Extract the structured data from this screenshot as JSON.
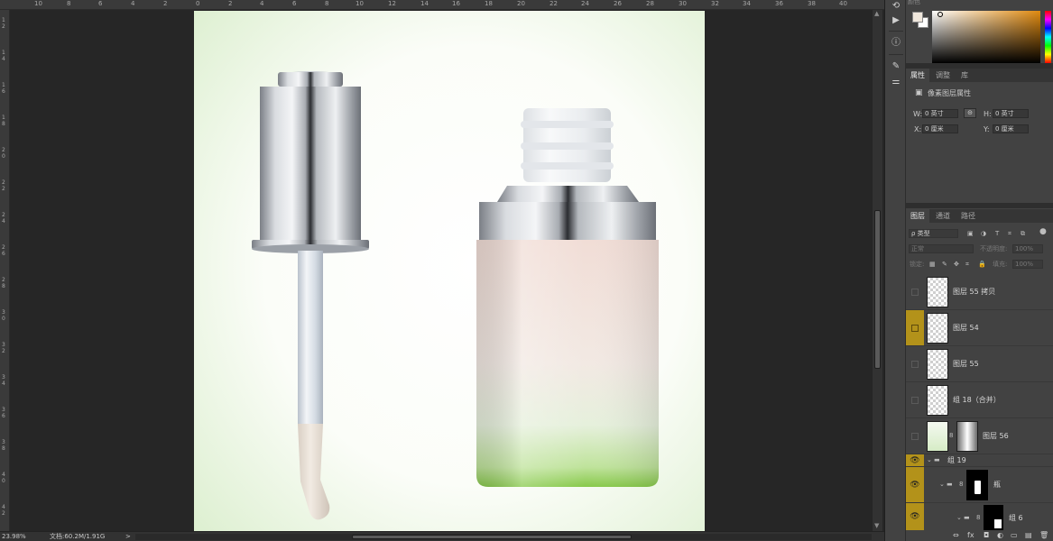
{
  "ruler": {
    "top_labels": [
      "10",
      "8",
      "6",
      "4",
      "2",
      "0",
      "2",
      "4",
      "6",
      "8",
      "10",
      "12",
      "14",
      "16",
      "18",
      "20",
      "22",
      "24",
      "26",
      "28",
      "30",
      "32",
      "34",
      "36",
      "38",
      "40"
    ],
    "left_labels": [
      "1 2",
      "1 4",
      "1 6",
      "1 8",
      "2 0",
      "2 2",
      "2 4",
      "2 6",
      "2 8",
      "3 0",
      "3 2",
      "3 4",
      "3 6",
      "3 8",
      "4 0",
      "4 2"
    ]
  },
  "statusbar": {
    "zoom": "23.98%",
    "doc_info": "文档:60.2M/1.91G",
    "arrow": ">"
  },
  "scroll": {
    "up": "▲",
    "down": "▼"
  },
  "iconstrip": {
    "icons": [
      {
        "name": "history-icon",
        "glyph": "⟲"
      },
      {
        "name": "actions-icon",
        "glyph": "▶"
      },
      {
        "name": "info-icon",
        "glyph": "ⓘ"
      },
      {
        "name": "brush-icon",
        "glyph": "✎"
      },
      {
        "name": "adjust-icon",
        "glyph": "⚌"
      }
    ]
  },
  "color": {
    "tabs_label": "颜色",
    "foreground": "#efe7dc",
    "background": "#ffffff"
  },
  "properties": {
    "tabs": [
      "属性",
      "调整",
      "库"
    ],
    "active_tab": "属性",
    "header": "像素图层属性",
    "w_label": "W:",
    "w_value": "0 英寸",
    "h_label": "H:",
    "h_value": "0 英寸",
    "x_label": "X:",
    "x_value": "0 厘米",
    "y_label": "Y:",
    "y_value": "0 厘米",
    "link_glyph": "⊝"
  },
  "layers": {
    "tabs": [
      "图层",
      "通道",
      "路径"
    ],
    "active_tab": "图层",
    "filter_kind": "ρ 类型",
    "filter_icons": [
      "▣",
      "◑",
      "T",
      "⌗",
      "⧉"
    ],
    "blend_mode": "正常",
    "opacity_label": "不透明度:",
    "opacity_value": "100%",
    "lock_label": "锁定:",
    "lock_icons": [
      "▦",
      "✎",
      "✥",
      "⌗",
      "🔒"
    ],
    "fill_label": "填充:",
    "fill_value": "100%",
    "items": [
      {
        "name": "图层 55 拷贝",
        "visible": false,
        "highlight": false
      },
      {
        "name": "图层 54",
        "visible": false,
        "highlight": true
      },
      {
        "name": "图层 55",
        "visible": false,
        "highlight": false
      },
      {
        "name": "组 18（合并）",
        "visible": false,
        "highlight": false
      },
      {
        "name": "图层 56",
        "visible": false,
        "highlight": false
      },
      {
        "name": "组 19",
        "visible": true,
        "highlight": true
      },
      {
        "name": "瓶",
        "visible": true,
        "highlight": true
      },
      {
        "name": "组 6",
        "visible": true,
        "highlight": true
      }
    ],
    "footer_icons": [
      "⇔",
      "fx",
      "◘",
      "◐",
      "▭",
      "▤",
      "🗑"
    ]
  }
}
